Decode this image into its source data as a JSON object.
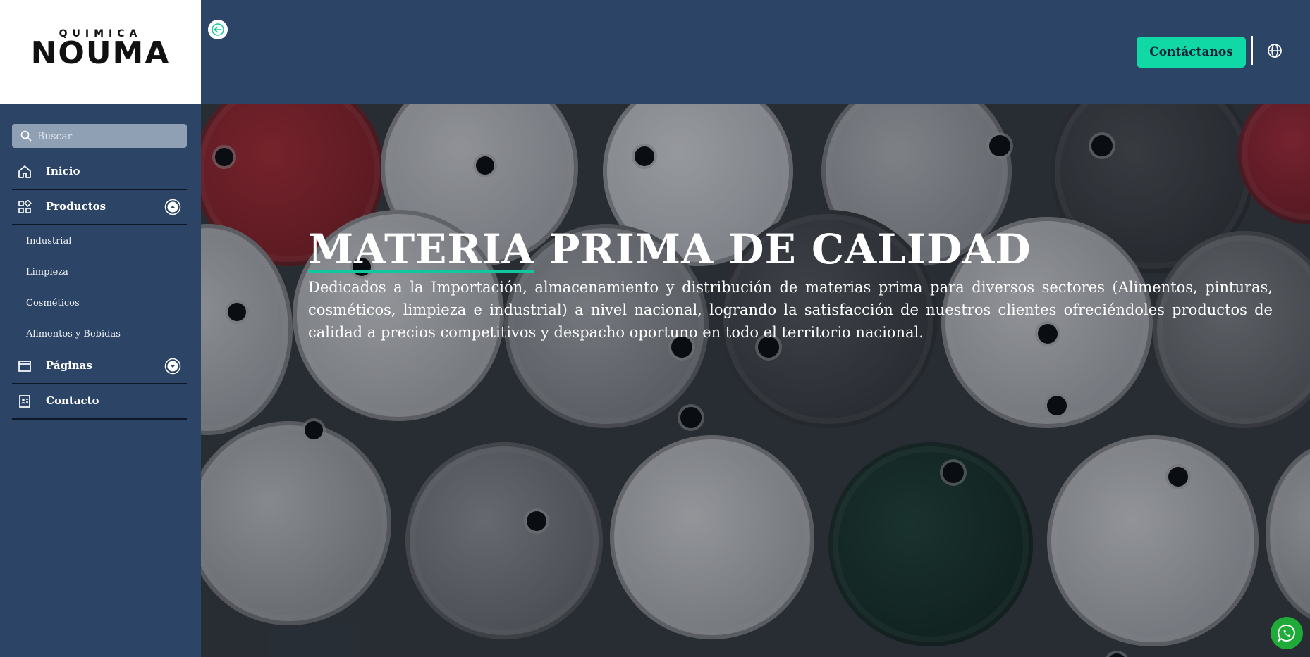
{
  "logo": {
    "small": "QUIMICA",
    "big": "NOUMA"
  },
  "search": {
    "placeholder": "Buscar"
  },
  "nav": {
    "inicio": "Inicio",
    "productos": "Productos",
    "productos_sub": [
      "Industrial",
      "Limpieza",
      "Cosméticos",
      "Alimentos y Bebidas"
    ],
    "paginas": "Páginas",
    "contacto": "Contacto"
  },
  "header": {
    "contact_label": "Contáctanos"
  },
  "hero": {
    "title": "MATERIA PRIMA DE CALIDAD",
    "text": "Dedicados a la Importación, almacenamiento y distribución de materias prima para diversos sectores (Alimentos, pinturas, cosméticos, limpieza e industrial) a nivel nacional, logrando la satisfacción de nuestros clientes ofreciéndoles productos de calidad a precios competitivos y despacho oportuno en todo el territorio nacional."
  },
  "icons": [
    "arrow-left-icon",
    "globe-icon",
    "search-icon",
    "home-icon",
    "grid-icon",
    "browser-icon",
    "contact-card-icon",
    "chevron-up-icon",
    "chevron-down-icon",
    "whatsapp-icon"
  ],
  "colors": {
    "navy": "#2c4465",
    "accent": "#10d9a6",
    "whatsapp": "#1faa3a"
  }
}
